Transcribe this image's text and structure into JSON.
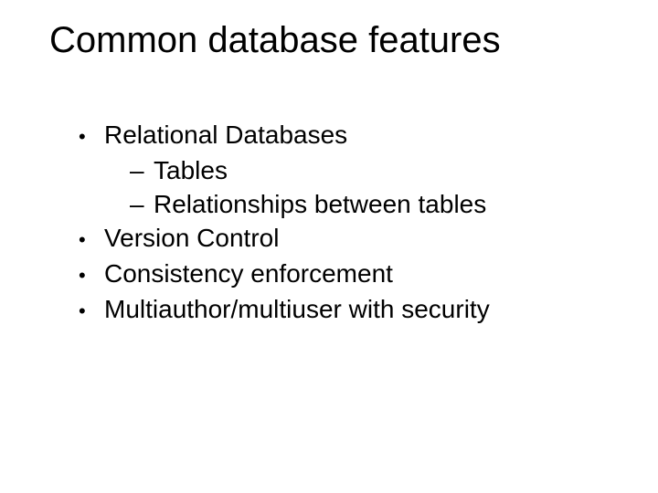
{
  "slide": {
    "title": "Common database features",
    "bullets": [
      {
        "text": "Relational Databases",
        "sub": [
          {
            "text": "Tables"
          },
          {
            "text": "Relationships between tables"
          }
        ]
      },
      {
        "text": "Version Control"
      },
      {
        "text": "Consistency enforcement"
      },
      {
        "text": "Multiauthor/multiuser with security"
      }
    ]
  }
}
